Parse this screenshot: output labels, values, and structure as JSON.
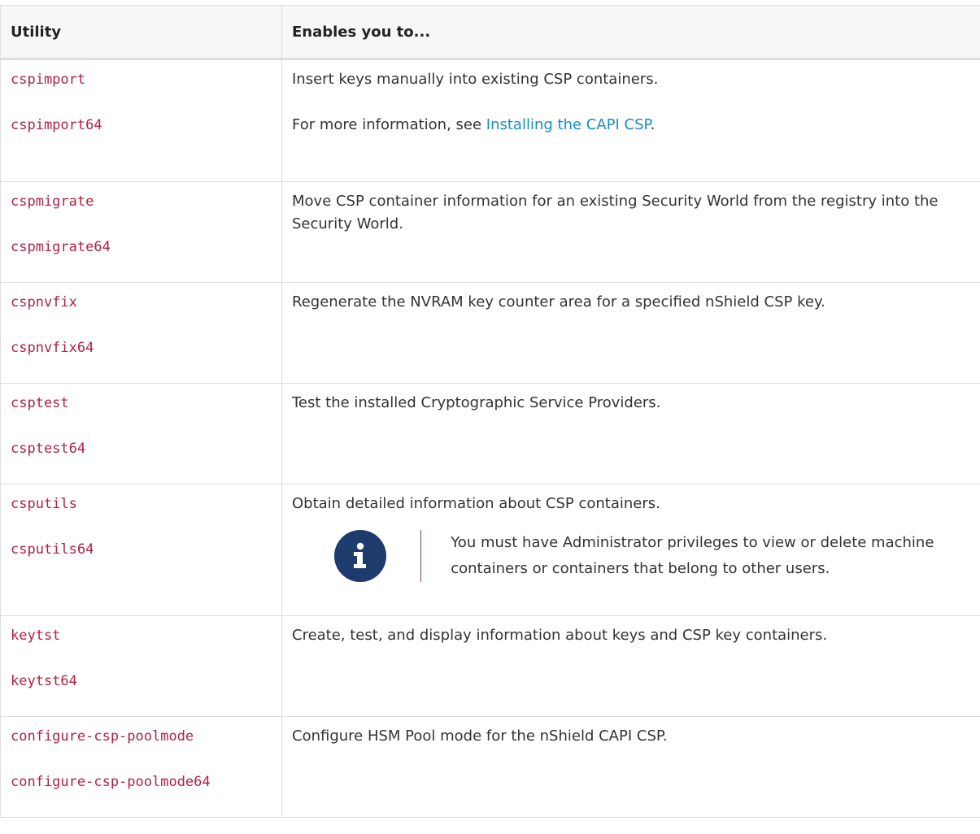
{
  "table": {
    "headers": [
      "Utility",
      "Enables you to..."
    ],
    "rows": [
      {
        "names": [
          "cspimport",
          "cspimport64"
        ],
        "desc": [
          "Insert keys manually into existing CSP containers."
        ],
        "info_prefix": "For more information, see ",
        "info_link": "Installing the CAPI CSP",
        "info_suffix": "."
      },
      {
        "names": [
          "cspmigrate",
          "cspmigrate64"
        ],
        "desc": [
          "Move CSP container information for an existing Security World from the registry into the Security World."
        ]
      },
      {
        "names": [
          "cspnvfix",
          "cspnvfix64"
        ],
        "desc": [
          "Regenerate the NVRAM key counter area for a specified nShield CSP key."
        ]
      },
      {
        "names": [
          "csptest",
          "csptest64"
        ],
        "desc": [
          "Test the installed Cryptographic Service Providers."
        ]
      },
      {
        "names": [
          "csputils",
          "csputils64"
        ],
        "desc": [
          "Obtain detailed information about CSP containers."
        ],
        "note": "You must have Administrator privileges to view or delete machine containers or containers that belong to other users.",
        "note_icon": "info-icon"
      },
      {
        "names": [
          "keytst",
          "keytst64"
        ],
        "desc": [
          "Create, test, and display information about keys and CSP key containers."
        ]
      },
      {
        "names": [
          "configure-csp-poolmode",
          "configure-csp-poolmode64"
        ],
        "desc": [
          "Configure HSM Pool mode for the nShield CAPI CSP."
        ]
      }
    ]
  },
  "colors": {
    "code_text": "#b12146",
    "link": "#1a8bc9",
    "info_icon_bg": "#1d3b6d",
    "note_bar": "#7a3d7a"
  }
}
